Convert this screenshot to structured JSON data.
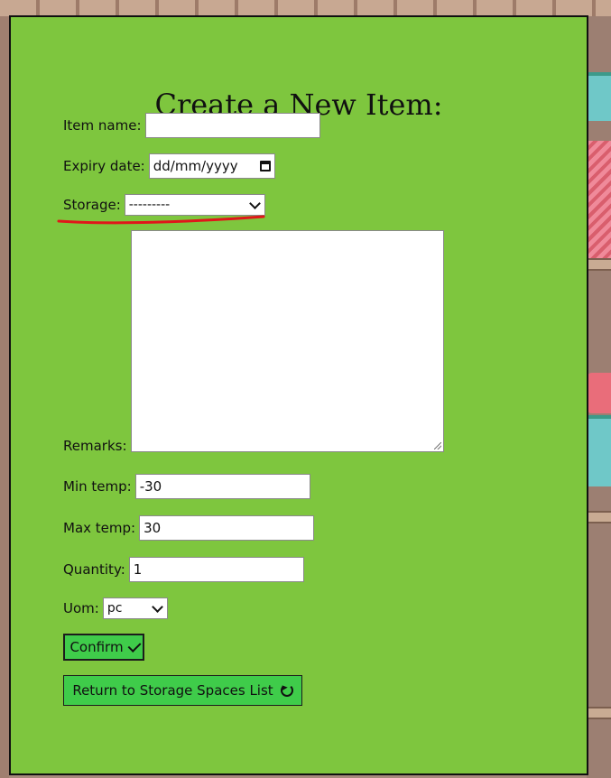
{
  "form": {
    "title": "Create a New Item:",
    "item_name": {
      "label": "Item name:",
      "value": ""
    },
    "expiry_date": {
      "label": "Expiry date:",
      "placeholder": "dd/mm/yyyy"
    },
    "storage": {
      "label": "Storage:",
      "selected": "---------"
    },
    "remarks": {
      "label": "Remarks:",
      "value": ""
    },
    "min_temp": {
      "label": "Min temp:",
      "value": "-30"
    },
    "max_temp": {
      "label": "Max temp:",
      "value": "30"
    },
    "quantity": {
      "label": "Quantity:",
      "value": "1"
    },
    "uom": {
      "label": "Uom:",
      "selected": "pc"
    },
    "confirm_label": "Confirm",
    "return_label": "Return to Storage Spaces List"
  },
  "colors": {
    "panel": "#7ec63e",
    "button": "#3fcc4a",
    "annotation": "#e0161a"
  }
}
